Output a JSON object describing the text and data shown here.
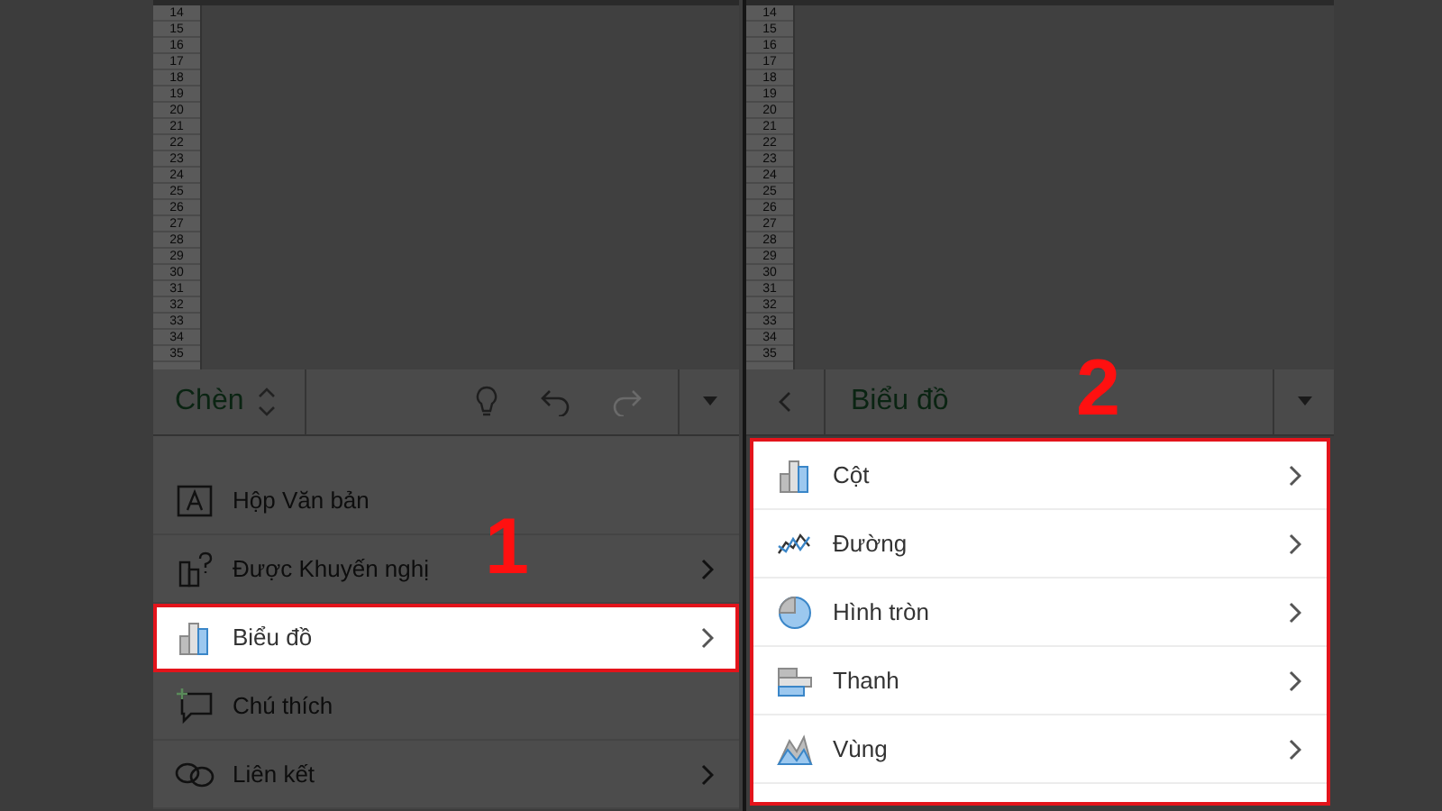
{
  "panels": [
    {
      "row_numbers": [
        "14",
        "15",
        "16",
        "17",
        "18",
        "19",
        "20",
        "21",
        "22",
        "23",
        "24",
        "25",
        "26",
        "27",
        "28",
        "29",
        "30",
        "31",
        "32",
        "33",
        "34",
        "35"
      ],
      "toolbar": {
        "kind": "tab-menu",
        "title": "Chèn",
        "redo_disabled": true
      },
      "items": [
        {
          "label": "Hộp Văn bản",
          "kind": "textbox",
          "has_submenu": false,
          "selected": false
        },
        {
          "label": "Được Khuyến nghị",
          "kind": "recommended",
          "has_submenu": true,
          "selected": false
        },
        {
          "label": "Biểu đồ",
          "kind": "column",
          "has_submenu": true,
          "selected": true
        },
        {
          "label": "Chú thích",
          "kind": "comment",
          "has_submenu": false,
          "selected": false
        },
        {
          "label": "Liên kết",
          "kind": "link",
          "has_submenu": true,
          "selected": false
        }
      ],
      "annotation": "1"
    },
    {
      "row_numbers": [
        "14",
        "15",
        "16",
        "17",
        "18",
        "19",
        "20",
        "21",
        "22",
        "23",
        "24",
        "25",
        "26",
        "27",
        "28",
        "29",
        "30",
        "31",
        "32",
        "33",
        "34",
        "35"
      ],
      "toolbar": {
        "kind": "back",
        "title": "Biểu đồ"
      },
      "items": [
        {
          "label": "Cột",
          "kind": "column",
          "has_submenu": true,
          "selected": false
        },
        {
          "label": "Đường",
          "kind": "line",
          "has_submenu": true,
          "selected": false
        },
        {
          "label": "Hình tròn",
          "kind": "pie",
          "has_submenu": true,
          "selected": false
        },
        {
          "label": "Thanh",
          "kind": "bar",
          "has_submenu": true,
          "selected": false
        },
        {
          "label": "Vùng",
          "kind": "area",
          "has_submenu": true,
          "selected": false
        }
      ],
      "annotation": "2"
    }
  ]
}
